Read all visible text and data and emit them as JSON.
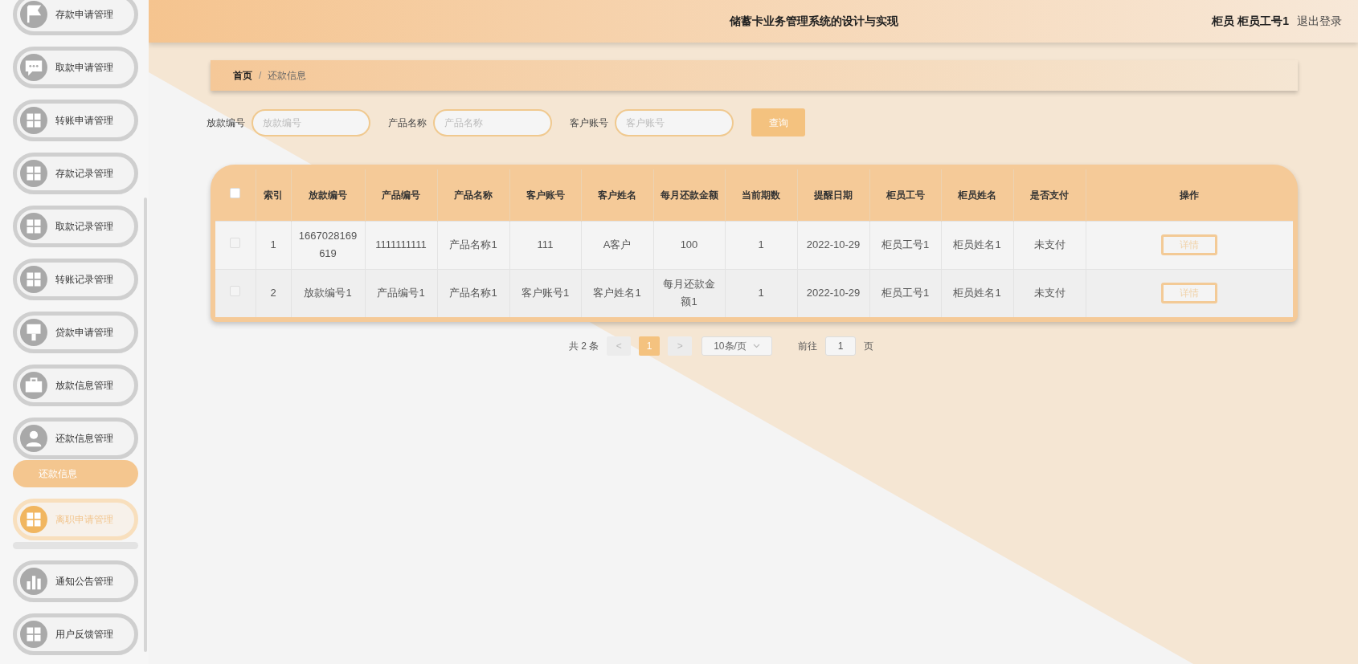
{
  "sidebar": {
    "items": [
      {
        "label": "存款申请管理",
        "hovered": false
      },
      {
        "label": "取款申请管理",
        "hovered": false
      },
      {
        "label": "转账申请管理",
        "hovered": false
      },
      {
        "label": "存款记录管理",
        "hovered": false
      },
      {
        "label": "取款记录管理",
        "hovered": false
      },
      {
        "label": "转账记录管理",
        "hovered": false
      },
      {
        "label": "贷款申请管理",
        "hovered": false
      },
      {
        "label": "放款信息管理",
        "hovered": false
      },
      {
        "label": "还款信息管理",
        "hovered": false,
        "children": [
          {
            "label": "还款信息",
            "selected": true
          }
        ]
      },
      {
        "label": "离职申请管理",
        "hovered": true
      },
      {
        "label": "通知公告管理",
        "hovered": false
      },
      {
        "label": "用户反馈管理",
        "hovered": false
      }
    ]
  },
  "header": {
    "title": "储蓄卡业务管理系统的设计与实现",
    "user_role": "柜员",
    "user_name": "柜员工号1",
    "logout": "退出登录"
  },
  "breadcrumb": [
    {
      "label": "首页"
    },
    {
      "label": "还款信息"
    }
  ],
  "breadcrumb_separator": "/",
  "search": {
    "fields": [
      {
        "label": "放款编号",
        "placeholder": "放款编号"
      },
      {
        "label": "产品名称",
        "placeholder": "产品名称"
      },
      {
        "label": "客户账号",
        "placeholder": "客户账号"
      }
    ],
    "button": "查询"
  },
  "table": {
    "select_all_checked": false,
    "columns": [
      "索引",
      "放款编号",
      "产品编号",
      "产品名称",
      "客户账号",
      "客户姓名",
      "每月还款金额",
      "当前期数",
      "提醒日期",
      "柜员工号",
      "柜员姓名",
      "是否支付",
      "操作"
    ],
    "rows": [
      {
        "checked": false,
        "cells": [
          "1",
          "1667028169619",
          "1111111111",
          "产品名称1",
          "111",
          "A客户",
          "100",
          "1",
          "2022-10-29",
          "柜员工号1",
          "柜员姓名1",
          "未支付"
        ],
        "action": "详情"
      },
      {
        "checked": false,
        "cells": [
          "2",
          "放款编号1",
          "产品编号1",
          "产品名称1",
          "客户账号1",
          "客户姓名1",
          "每月还款金额1",
          "1",
          "2022-10-29",
          "柜员工号1",
          "柜员姓名1",
          "未支付"
        ],
        "action": "详情"
      }
    ]
  },
  "pagination": {
    "total": "共 2 条",
    "prev": "<",
    "pages": [
      {
        "label": "1",
        "selected": true
      }
    ],
    "next": ">",
    "page_size": "10条/页",
    "goto_label": "前往",
    "goto_value": "1",
    "goto_suffix": "页"
  }
}
